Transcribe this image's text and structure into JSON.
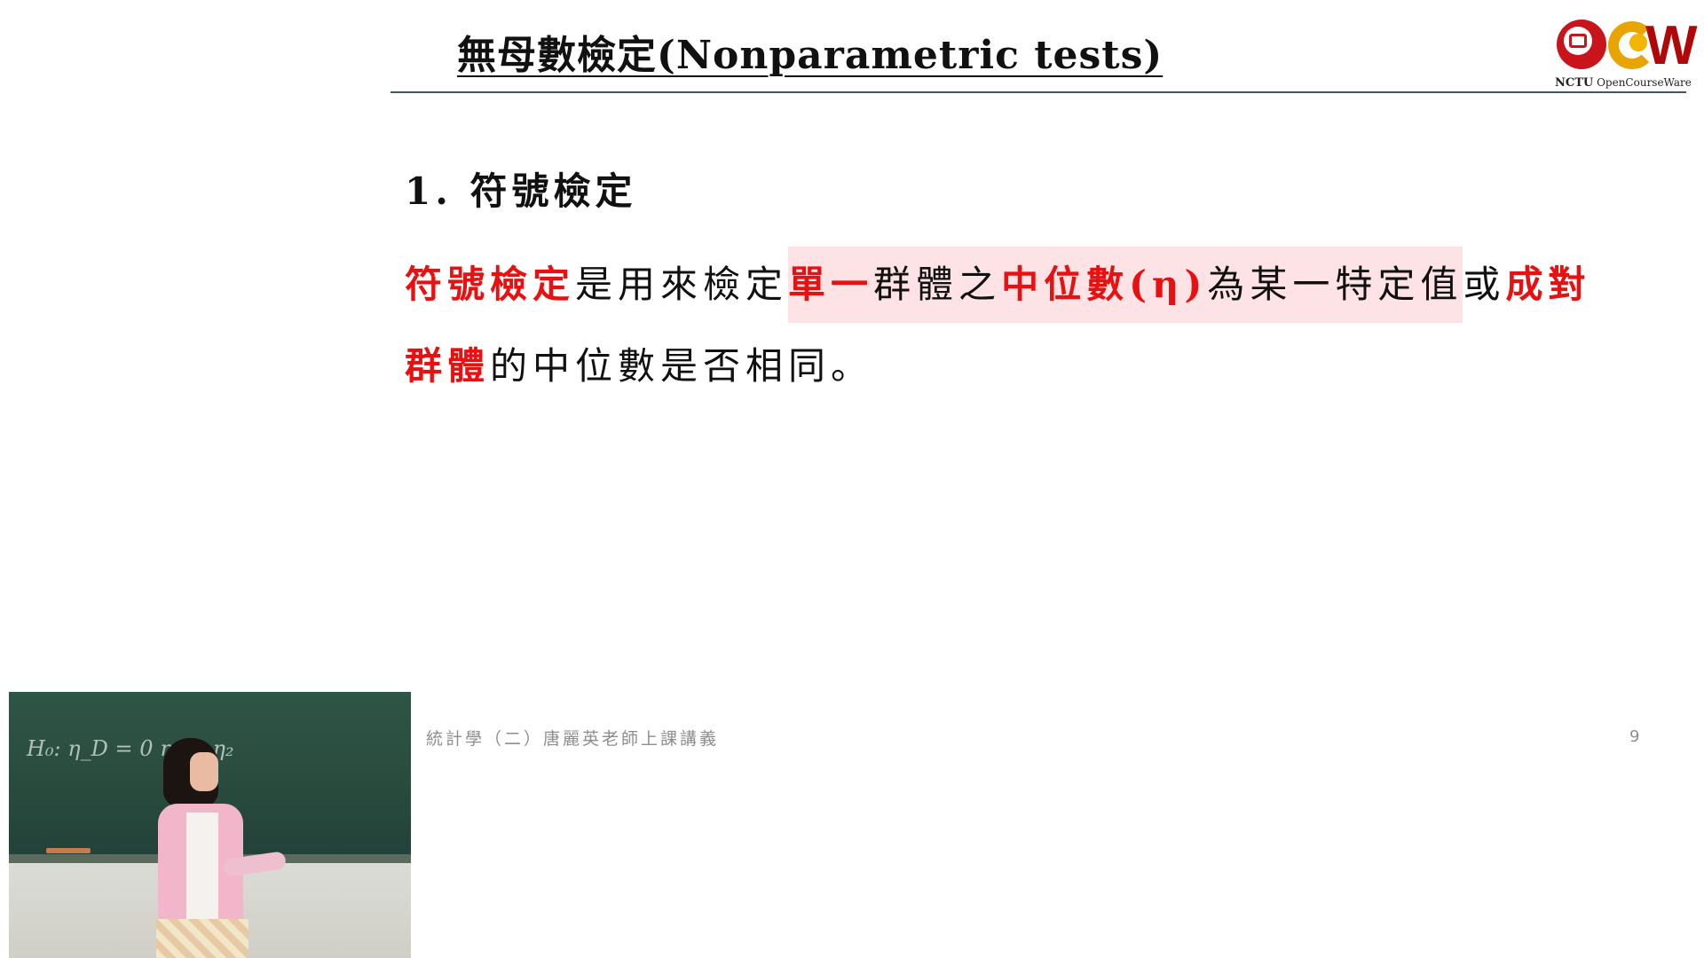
{
  "slide": {
    "title": "無母數檢定(Nonparametric tests)",
    "section_heading": "1. 符號檢定",
    "paragraph": {
      "line1": {
        "term1": "符號檢定",
        "text1": "是用來檢定",
        "hl_part1": "單一",
        "hl_part2": "群體之",
        "hl_part3": "中位數(η)",
        "hl_part4": "為某一特定值",
        "text2": "或",
        "term2": "成對"
      },
      "line2": {
        "term3": "群體",
        "text3": "的中位數是否相同。"
      }
    },
    "footer": "統計學（二）唐麗英老師上課講義",
    "page_number": "9"
  },
  "logo": {
    "brand": "NCTU",
    "sub": "OpenCourseWare",
    "letter": "W"
  },
  "video": {
    "chalk_text": "H₀: η_D = 0   η₁ = η₂"
  },
  "colors": {
    "emphasis_red": "#e81010",
    "highlight_pink": "#fde3e5",
    "rule": "#3d5566",
    "footer_gray": "#8e8e8e"
  }
}
